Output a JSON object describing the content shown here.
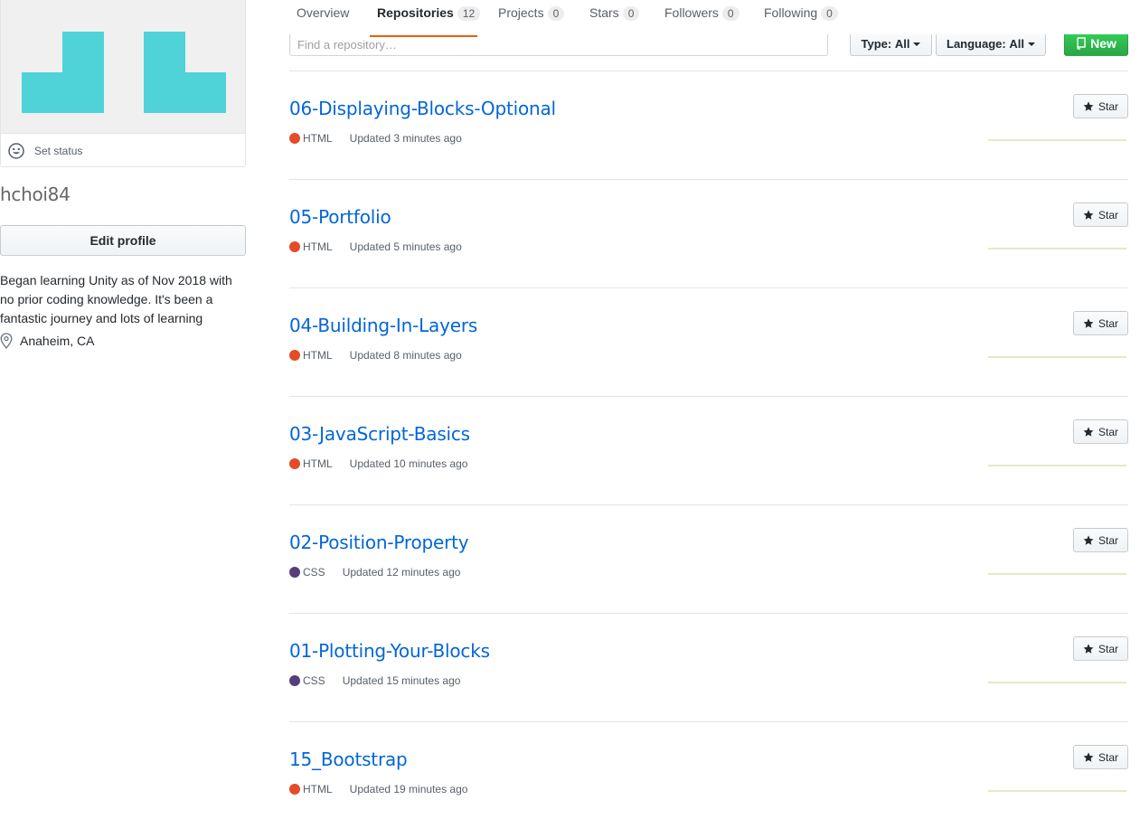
{
  "profile": {
    "set_status": "Set status",
    "username": "hchoi84",
    "edit_profile": "Edit profile",
    "bio_lines": [
      "Began learning Unity as of Nov 2018 with",
      "no prior coding knowledge. It's been a",
      "fantastic journey and lots of learning"
    ],
    "location": "Anaheim, CA",
    "avatar_color": "#4fd3d8"
  },
  "tabs": [
    {
      "label": "Overview",
      "count": null,
      "selected": false
    },
    {
      "label": "Repositories",
      "count": "12",
      "selected": true
    },
    {
      "label": "Projects",
      "count": "0",
      "selected": false
    },
    {
      "label": "Stars",
      "count": "0",
      "selected": false
    },
    {
      "label": "Followers",
      "count": "0",
      "selected": false
    },
    {
      "label": "Following",
      "count": "0",
      "selected": false
    }
  ],
  "filters": {
    "search_placeholder": "Find a repository…",
    "type_label": "Type:",
    "type_value": "All",
    "language_label": "Language:",
    "language_value": "All",
    "new_label": "New"
  },
  "star_label": "Star",
  "languages": {
    "HTML": "#e34c26",
    "CSS": "#563d7c"
  },
  "repos": [
    {
      "name": "06-Displaying-Blocks-Optional",
      "language": "HTML",
      "updated": "Updated 3 minutes ago"
    },
    {
      "name": "05-Portfolio",
      "language": "HTML",
      "updated": "Updated 5 minutes ago"
    },
    {
      "name": "04-Building-In-Layers",
      "language": "HTML",
      "updated": "Updated 8 minutes ago"
    },
    {
      "name": "03-JavaScript-Basics",
      "language": "HTML",
      "updated": "Updated 10 minutes ago"
    },
    {
      "name": "02-Position-Property",
      "language": "CSS",
      "updated": "Updated 12 minutes ago"
    },
    {
      "name": "01-Plotting-Your-Blocks",
      "language": "CSS",
      "updated": "Updated 15 minutes ago"
    },
    {
      "name": "15_Bootstrap",
      "language": "HTML",
      "updated": "Updated 19 minutes ago"
    }
  ]
}
